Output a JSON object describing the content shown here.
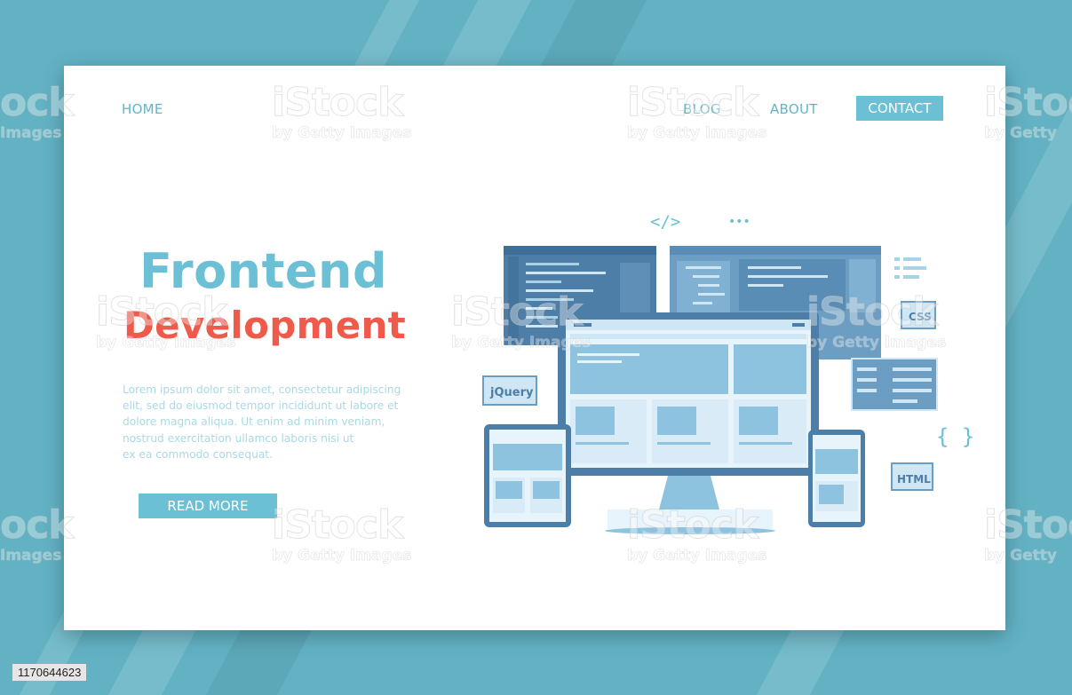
{
  "nav": {
    "home": "HOME",
    "blog": "BLOG",
    "about": "ABOUT",
    "contact": "CONTACT"
  },
  "hero": {
    "title_line1": "Frontend",
    "title_line2": "Development",
    "body_lines": [
      "Lorem ipsum dolor sit amet, consectetur adipiscing",
      "elit, sed do eiusmod tempor incididunt ut labore et",
      "dolore magna aliqua. Ut enim ad minim veniam,",
      "nostrud exercitation ullamco laboris nisi ut",
      "ex ea commodo consequat."
    ],
    "read_more": "READ MORE"
  },
  "illustration": {
    "tags": {
      "code_tag": "</>",
      "dots": "•••",
      "css": "CSS",
      "jquery": "jQuery",
      "braces": "{ }",
      "html": "HTML"
    }
  },
  "watermark": {
    "main": "iStock",
    "sub": "by Getty Images",
    "edge_main": "ock",
    "edge_sub": "Images",
    "edge_right_sub": "by Getty"
  },
  "stock_id": "1170644623",
  "colors": {
    "background": "#62b2c4",
    "accent": "#6cc0d6",
    "title_red": "#ef5a4a",
    "screen_dark": "#4f7fa6",
    "screen_light": "#cfe6f4"
  }
}
